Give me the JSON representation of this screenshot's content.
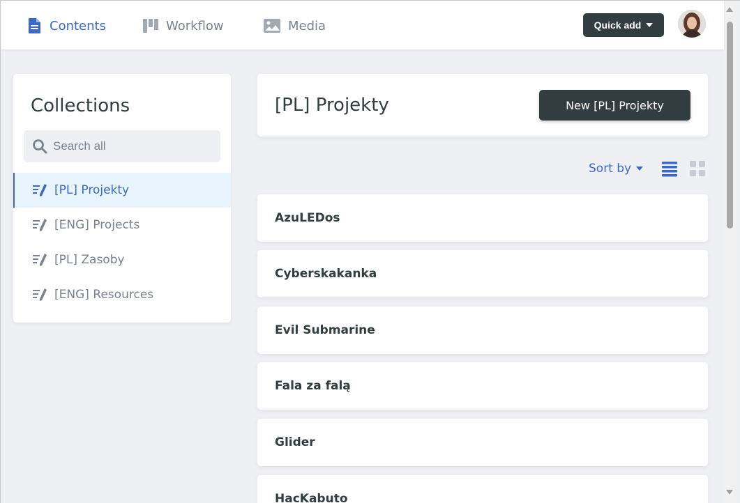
{
  "nav": {
    "contents": "Contents",
    "workflow": "Workflow",
    "media": "Media"
  },
  "header": {
    "quick_add": "Quick add",
    "avatar_alt": "User avatar"
  },
  "sidebar": {
    "title": "Collections",
    "search_placeholder": "Search all",
    "items": [
      {
        "label": "[PL] Projekty",
        "active": true
      },
      {
        "label": "[ENG] Projects",
        "active": false
      },
      {
        "label": "[PL] Zasoby",
        "active": false
      },
      {
        "label": "[ENG] Resources",
        "active": false
      }
    ]
  },
  "main": {
    "title": "[PL] Projekty",
    "new_button": "New [PL] Projekty",
    "sort_by": "Sort by",
    "entries": [
      "AzuLEDos",
      "Cyberskakanka",
      "Evil Submarine",
      "Fala za falą",
      "Glider",
      "HacKabuto"
    ]
  },
  "colors": {
    "accent": "#3a69c7",
    "dark": "#313d3e",
    "muted": "#798291",
    "background": "#eff0f4",
    "active_bg": "#e8f5fe"
  }
}
